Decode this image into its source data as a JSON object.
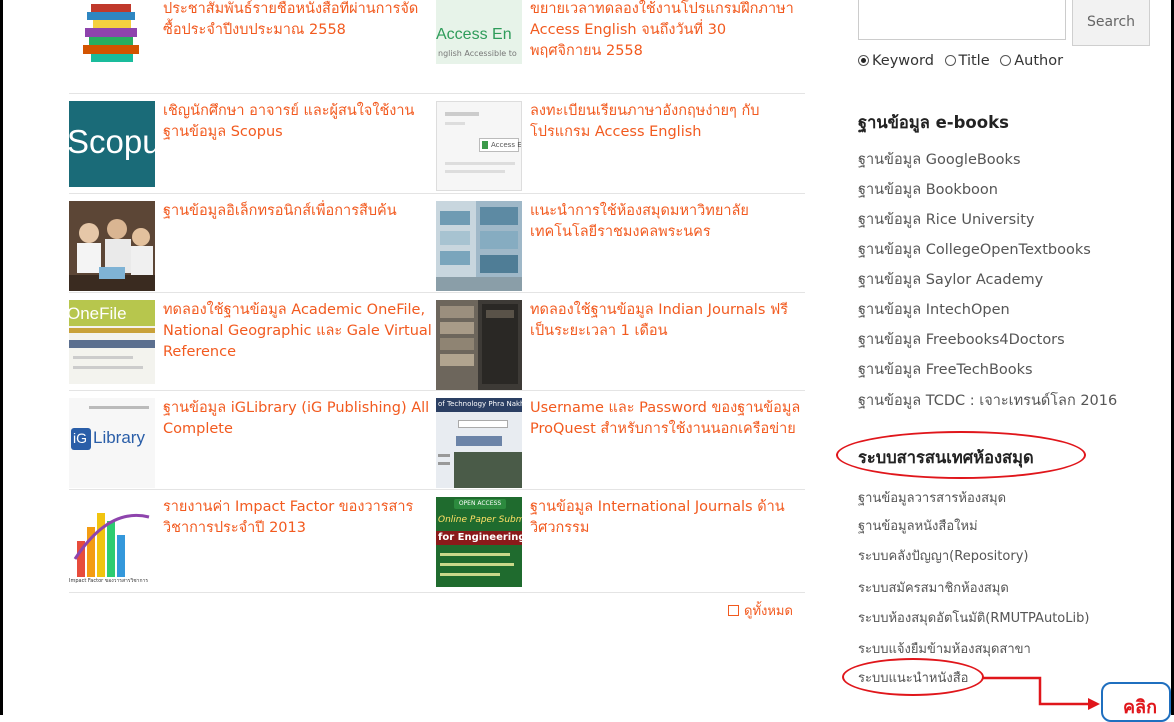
{
  "cards": [
    {
      "title": "ประชาสัมพันธ์รายชื่อหนังสือที่ผ่านการจัดซื้อประจำปีงบประมาณ 2558",
      "thumb": "books-icon"
    },
    {
      "title": "ขยายเวลาทดลองใช้งานโปรแกรมฝึกภาษา Access English จนถึงวันที่ 30 พฤศจิกายน 2558",
      "thumb": "access-english-logo",
      "thumb_text": "Access En",
      "thumb_sub": "nglish Accessible to"
    },
    {
      "title": "เชิญนักศึกษา อาจารย์ และผู้สนใจใช้งานฐานข้อมูล Scopus",
      "thumb": "scopus-logo",
      "thumb_text": "Scopus"
    },
    {
      "title": "ลงทะเบียนเรียนภาษาอังกฤษง่ายๆ กับโปรแกรม Access English",
      "thumb": "access-english-screenshot",
      "thumb_text": "Access E"
    },
    {
      "title": "ฐานข้อมูลอิเล็กทรอนิกส์เพื่อการสืบค้น",
      "thumb": "students-photo"
    },
    {
      "title": "แนะนำการใช้ห้องสมุดมหาวิทยาลัยเทคโนโลยีราชมงคลพระนคร",
      "thumb": "library-shelves-photo"
    },
    {
      "title": "ทดลองใช้ฐานข้อมูล Academic OneFile, National Geographic และ Gale Virtual Reference",
      "thumb": "onefile-screenshot",
      "thumb_text": "OneFile"
    },
    {
      "title": "ทดลองใช้ฐานข้อมูล Indian Journals ฟรีเป็นระยะเวลา 1 เดือน",
      "thumb": "bookshelf-photo"
    },
    {
      "title": "ฐานข้อมูล iGLibrary (iG Publishing) All Complete",
      "thumb": "iglibrary-logo",
      "thumb_text": "Library",
      "thumb_prefix": "iG"
    },
    {
      "title": "Username และ Password ของฐานข้อมูล ProQuest สำหรับการใช้งานนอกเครือข่าย",
      "thumb": "proquest-screenshot",
      "thumb_text": "of Technology Phra Nakhon"
    },
    {
      "title": "รายงานค่า Impact Factor ของวารสารวิชาการประจำปี 2013",
      "thumb": "impact-factor-chart",
      "thumb_text": "Impact Factor ของวารสารวิชาการ"
    },
    {
      "title": "ฐานข้อมูล International Journals ด้านวิศวกรรม",
      "thumb": "engineering-journals-banner",
      "thumb_text": "for Engineering and",
      "thumb_sub": "Online Paper Submission",
      "thumb_badge": "OPEN ACCESS"
    }
  ],
  "view_all": "ดูทั้งหมด",
  "search": {
    "button": "Search",
    "value": ""
  },
  "search_options": [
    {
      "label": "Keyword",
      "selected": true
    },
    {
      "label": "Title",
      "selected": false
    },
    {
      "label": "Author",
      "selected": false
    }
  ],
  "ebooks": {
    "heading": "ฐานข้อมูล e-books",
    "items": [
      "ฐานข้อมูล GoogleBooks",
      "ฐานข้อมูล Bookboon",
      "ฐานข้อมูล Rice University",
      "ฐานข้อมูล CollegeOpenTextbooks",
      "ฐานข้อมูล Saylor Academy",
      "ฐานข้อมูล IntechOpen",
      "ฐานข้อมูล Freebooks4Doctors",
      "ฐานข้อมูล FreeTechBooks",
      "ฐานข้อมูล TCDC : เจาะเทรนด์โลก 2016"
    ]
  },
  "library_systems": {
    "heading": "ระบบสารสนเทศห้องสมุด",
    "items": [
      "ฐานข้อมูลวารสารห้องสมุด",
      "ฐานข้อมูลหนังสือใหม่",
      "ระบบคลังปัญญา(Repository)",
      "ระบบสมัครสมาชิกห้องสมุด",
      "ระบบห้องสมุดอัตโนมัติ(RMUTPAutoLib)",
      "ระบบแจ้งยืมข้ามห้องสมุดสาขา",
      "ระบบแนะนำหนังสือ"
    ]
  },
  "callout": {
    "label": "คลิก"
  },
  "colors": {
    "link": "#f25a1f",
    "annotation": "#e0161b",
    "callout_border": "#1f6fbf"
  }
}
